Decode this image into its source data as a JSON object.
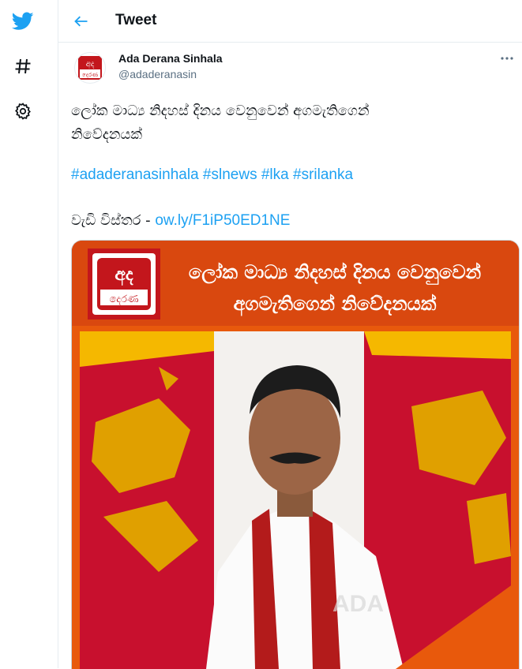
{
  "sidebar": {
    "items": [
      {
        "name": "twitter-logo-icon"
      },
      {
        "name": "explore-hashtag-icon"
      },
      {
        "name": "settings-gear-icon"
      }
    ]
  },
  "header": {
    "title": "Tweet"
  },
  "tweet": {
    "author_name": "Ada Derana Sinhala",
    "author_handle": "@adaderanasin",
    "avatar_text_top": "අද",
    "avatar_text_bottom": "දෙරණ",
    "text_line1": "ලෝක මාධ්‍ය නිදහස් දිනය වෙනුවෙන් අගමැතිගෙන්",
    "text_line2": "නිවේදනයක්",
    "hashtags": [
      "#adaderanasinhala",
      "#slnews",
      "#lka",
      "#srilanka"
    ],
    "more_label": "වැඩි විස්තර -",
    "link": "ow.ly/F1iP50ED1NE"
  },
  "media": {
    "logo_top": "අද",
    "logo_bottom": "දෙරණ",
    "headline_line1": "ලෝක මාධ්‍ය නිදහස් දිනය වෙනුවෙන්",
    "headline_line2": "අගමැතිගෙන් නිවේදනයක්",
    "watermark": "ADA"
  },
  "colors": {
    "accent": "#1da1f2",
    "brand_orange": "#e8590c",
    "brand_red": "#c3161c",
    "flag_red": "#c8102e",
    "flag_yellow": "#f5b800"
  }
}
